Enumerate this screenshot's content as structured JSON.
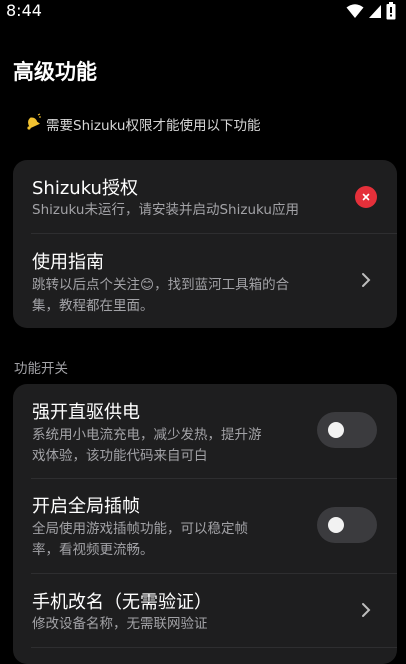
{
  "status_bar": {
    "time": "8:44",
    "icons": [
      "wifi-icon",
      "signal-icon",
      "battery-icon"
    ]
  },
  "page": {
    "title": "高级功能"
  },
  "notice": {
    "icon": "bell-icon",
    "text": "需要Shizuku权限才能使用以下功能"
  },
  "card_top": {
    "shizuku": {
      "title": "Shizuku授权",
      "desc": "Shizuku未运行，请安装并启动Shizuku应用",
      "status_icon": "error-close-icon",
      "status_color": "#e5303a"
    },
    "guide": {
      "title": "使用指南",
      "desc_line1": "跳转以后点个关注😊，找到蓝河工具箱的合",
      "desc_line2": "集，教程都在里面。"
    }
  },
  "section": {
    "label": "功能开关"
  },
  "features": {
    "direct_power": {
      "title": "强开直驱供电",
      "desc_line1": "系统用小电流充电，减少发热，提升游",
      "desc_line2": "戏体验，该功能代码来自可白",
      "enabled": false
    },
    "frame_interp": {
      "title": "开启全局插帧",
      "desc_line1": "全局使用游戏插帧功能，可以稳定帧",
      "desc_line2": "率，看视频更流畅。",
      "enabled": false
    },
    "rename": {
      "title": "手机改名（无需验证）",
      "desc": "修改设备名称，无需联网验证"
    }
  }
}
